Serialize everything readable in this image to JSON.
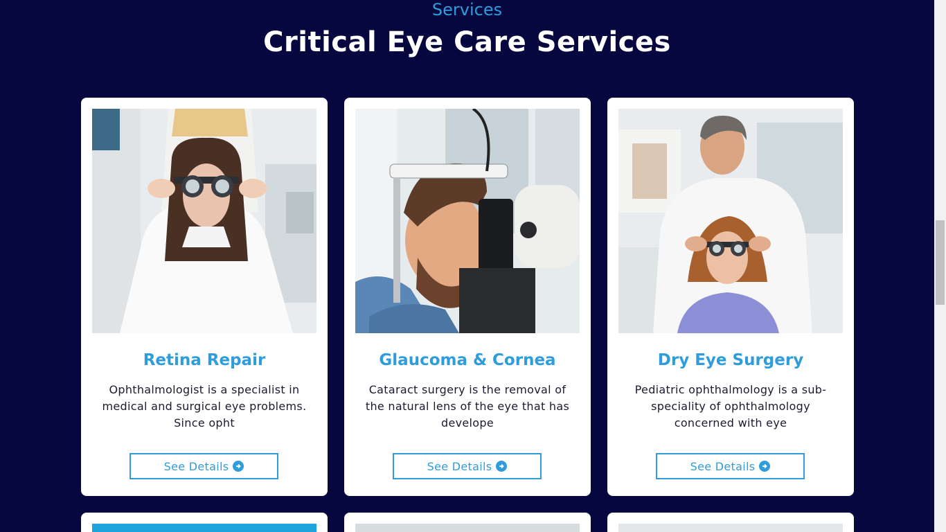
{
  "header": {
    "eyebrow": "Services",
    "title": "Critical Eye Care Services"
  },
  "cards": [
    {
      "image": "woman-eye-exam-trial-frame-photo",
      "title": "Retina Repair",
      "text": "Ophthalmologist is a specialist in medical and surgical eye problems. Since opht",
      "button_label": "See Details"
    },
    {
      "image": "man-slit-lamp-exam-photo",
      "title": "Glaucoma & Cornea",
      "text": "Cataract surgery is the removal of the natural lens of the eye that has develope",
      "button_label": "See Details"
    },
    {
      "image": "doctor-fitting-trial-frame-photo",
      "title": "Dry Eye Surgery",
      "text": "Pediatric ophthalmology is a sub-speciality of ophthalmology concerned with eye",
      "button_label": "See Details"
    }
  ],
  "icons": {
    "button_icon": "arrow-circle-right-icon"
  },
  "colors": {
    "background": "#06073f",
    "accent": "#2f9cdb",
    "card": "#ffffff"
  }
}
